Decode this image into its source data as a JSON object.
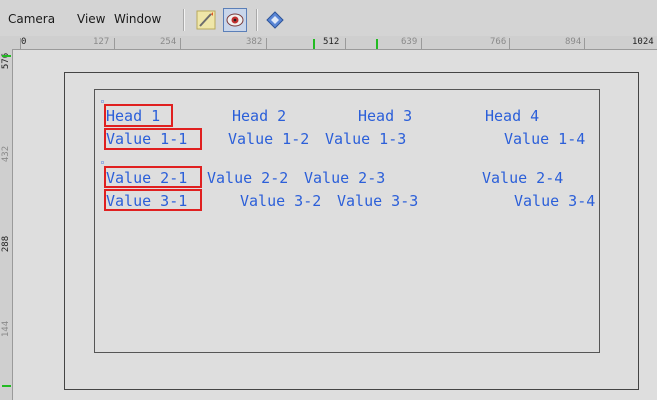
{
  "menu": {
    "items": [
      "Camera",
      "View",
      "Window"
    ]
  },
  "toolbar": {
    "buttons": [
      {
        "icon": "pencil-icon",
        "active": false
      },
      {
        "icon": "camera-eye-icon",
        "active": true
      },
      {
        "icon": "diamond-nav-icon",
        "active": false
      }
    ]
  },
  "ruler_top": {
    "labels": [
      "0",
      "127",
      "254",
      "382",
      "512",
      "639",
      "766",
      "894",
      "1024"
    ],
    "strong_labels": [
      "0",
      "512",
      "1024"
    ]
  },
  "ruler_left": {
    "labels": [
      "576",
      "432",
      "288",
      "144"
    ],
    "strong_labels": [
      "576",
      "288"
    ]
  },
  "table": {
    "headers": [
      "Head 1",
      "Head 2",
      "Head 3",
      "Head 4"
    ],
    "rows": [
      [
        "Value 1-1",
        "Value 1-2",
        "Value 1-3",
        "Value 1-4"
      ],
      [
        "Value 2-1",
        "Value 2-2",
        "Value 2-3",
        "Value 2-4"
      ],
      [
        "Value 3-1",
        "Value 3-2",
        "Value 3-3",
        "Value 3-4"
      ]
    ]
  },
  "colors": {
    "text": "#2b5fd9",
    "selection": "#e02020",
    "ruler_marker": "#22bb22"
  }
}
